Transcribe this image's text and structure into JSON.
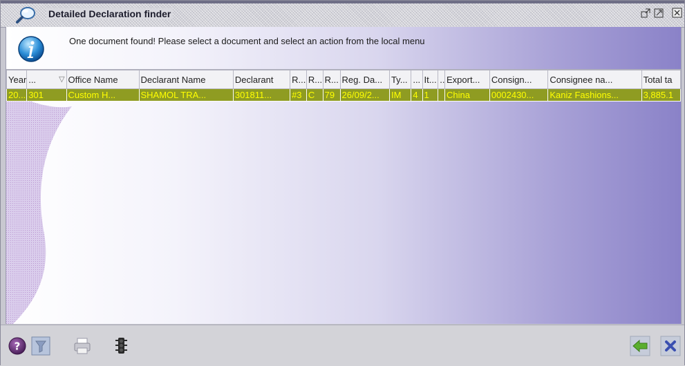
{
  "window": {
    "title": "Detailed Declaration finder"
  },
  "message": "One document found! Please select a document and select an action from the local menu",
  "table": {
    "columns": [
      "Year",
      "...",
      "Office Name",
      "Declarant Name",
      "Declarant",
      "R...",
      "R...",
      "R...",
      "Reg. Da...",
      "Ty...",
      "...",
      "It...",
      "...",
      "Export...",
      "Consign...",
      "Consignee na...",
      "Total ta"
    ],
    "sort_indicator": "▽",
    "rows": [
      [
        "20...",
        "301",
        "Custom H...",
        "SHAMOL TRA...",
        "301811...",
        "#3",
        "C",
        "79",
        "26/09/2...",
        "IM",
        "4",
        "1",
        "",
        "China",
        "0002430...",
        "Kaniz Fashions...",
        "3,885.1"
      ]
    ]
  },
  "colors": {
    "selected_row_bg": "#8f9c22",
    "selected_row_text": "#ffff00"
  },
  "icons": {
    "title": "magnifier-icon",
    "info": "info-icon",
    "restore": "restore-window-icon",
    "maximize": "maximize-window-icon",
    "close": "close-window-icon",
    "help": "help-icon",
    "filter": "filter-icon",
    "print": "print-icon",
    "traffic": "traffic-light-icon",
    "back": "back-arrow-icon",
    "cancel": "cancel-icon"
  }
}
